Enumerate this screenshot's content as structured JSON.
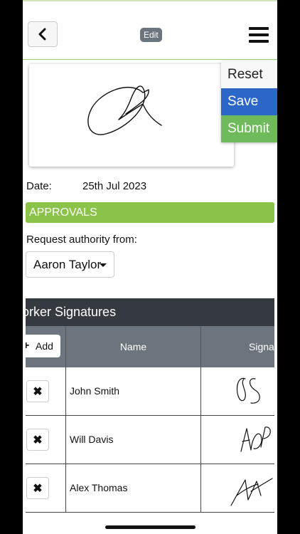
{
  "header": {
    "edit_label": "Edit"
  },
  "actions": {
    "reset": "Reset",
    "save": "Save",
    "submit": "Submit"
  },
  "form": {
    "date_label": "Date:",
    "date_value": "25th Jul 2023",
    "approvals_title": "APPROVALS",
    "request_label": "Request authority from:",
    "authority_selected": "Aaron Taylor"
  },
  "workers": {
    "title": "orker Signatures",
    "add_label": "Add",
    "columns": {
      "name": "Name",
      "signature": "Signature"
    },
    "rows": [
      {
        "name": "John Smith"
      },
      {
        "name": "Will Davis"
      },
      {
        "name": "Alex Thomas"
      }
    ]
  },
  "colors": {
    "accent_green": "#8bc34a",
    "save_blue": "#2c66c7",
    "submit_green": "#6fbb5c",
    "table_dark": "#343a40",
    "table_head": "#6c757d"
  },
  "icons": {
    "back": "chevron-left-icon",
    "menu": "hamburger-icon",
    "add": "plus-icon",
    "delete": "close-icon"
  }
}
